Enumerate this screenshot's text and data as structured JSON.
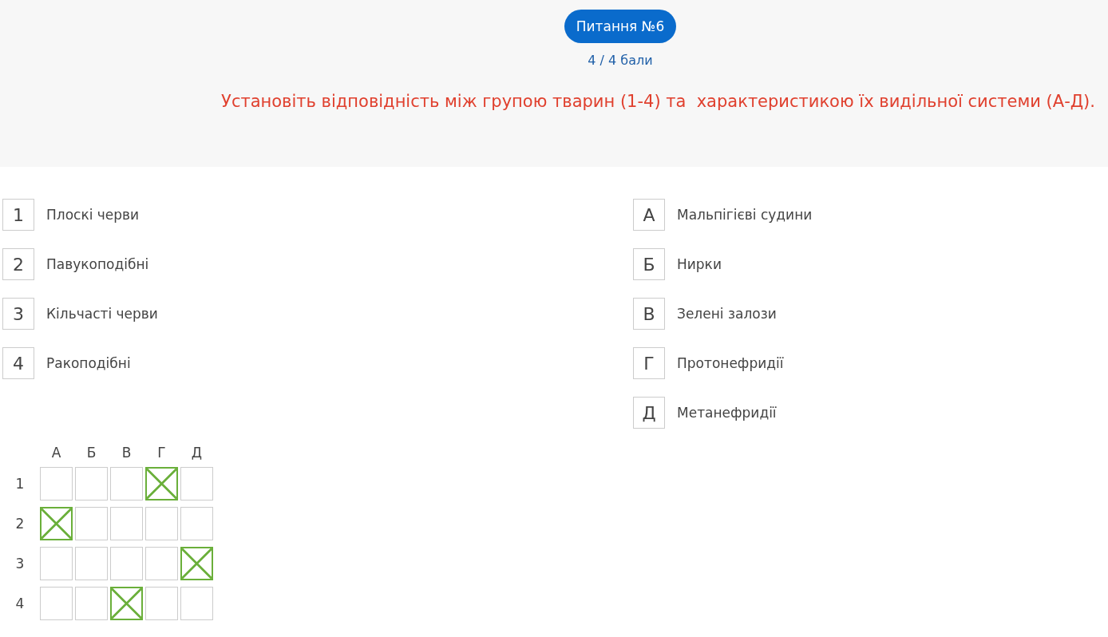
{
  "header": {
    "badge": "Питання №6",
    "score": "4 / 4 бали",
    "question": "Установіть відповідність між групою тварин (1-4) та  характеристикою їх видільної системи (А-Д)."
  },
  "left_items": [
    {
      "key": "1",
      "text": "Плоскі черви"
    },
    {
      "key": "2",
      "text": "Павукоподібні"
    },
    {
      "key": "3",
      "text": "Кільчасті черви"
    },
    {
      "key": "4",
      "text": "Ракоподібні"
    }
  ],
  "right_items": [
    {
      "key": "А",
      "text": "Мальпігієві судини"
    },
    {
      "key": "Б",
      "text": "Нирки"
    },
    {
      "key": "В",
      "text": "Зелені залози"
    },
    {
      "key": "Г",
      "text": "Протонефридії"
    },
    {
      "key": "Д",
      "text": "Метанефридії"
    }
  ],
  "answer_grid": {
    "columns": [
      "А",
      "Б",
      "В",
      "Г",
      "Д"
    ],
    "rows": [
      {
        "label": "1",
        "cells": [
          {
            "checked": false
          },
          {
            "checked": false
          },
          {
            "checked": false
          },
          {
            "checked": true
          },
          {
            "checked": false
          }
        ]
      },
      {
        "label": "2",
        "cells": [
          {
            "checked": true
          },
          {
            "checked": false
          },
          {
            "checked": false
          },
          {
            "checked": false
          },
          {
            "checked": false
          }
        ]
      },
      {
        "label": "3",
        "cells": [
          {
            "checked": false
          },
          {
            "checked": false
          },
          {
            "checked": false
          },
          {
            "checked": false
          },
          {
            "checked": true
          }
        ]
      },
      {
        "label": "4",
        "cells": [
          {
            "checked": false
          },
          {
            "checked": false
          },
          {
            "checked": true
          },
          {
            "checked": false
          },
          {
            "checked": false
          }
        ]
      }
    ]
  }
}
